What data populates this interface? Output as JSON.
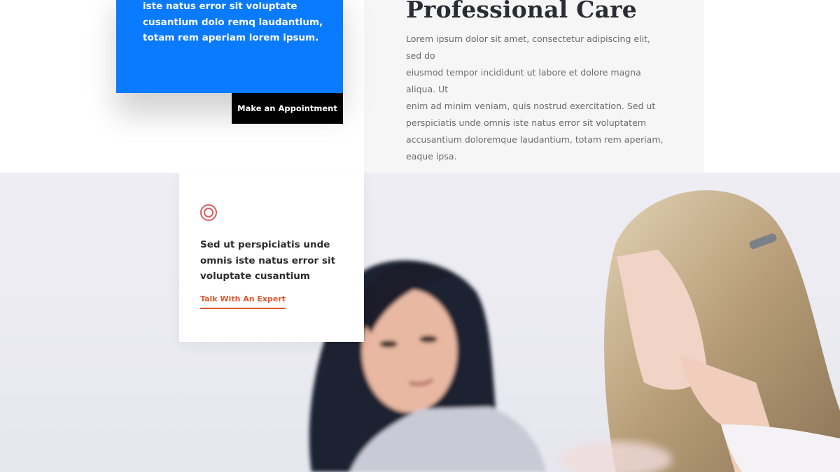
{
  "blue_card": {
    "text_lines": [
      "iste natus error sit voluptate",
      "cusantium dolo remq laudantium,",
      "totam rem aperiam lorem ipsum."
    ],
    "button_label": "Make an Appointment",
    "background_color": "#0a7aff"
  },
  "main": {
    "heading": "Professional Care",
    "paragraph_lines": [
      "Lorem ipsum dolor sit amet, consectetur adipiscing elit, sed do",
      "eiusmod tempor incididunt ut labore et dolore magna aliqua. Ut",
      "enim ad minim veniam, quis nostrud exercitation. Sed ut",
      "perspiciatis unde omnis iste natus error sit voluptatem",
      "accusantium doloremque laudantium, totam rem aperiam,",
      "eaque ipsa."
    ]
  },
  "feature_card": {
    "icon": "target-icon",
    "title_lines": [
      "Sed ut perspiciatis unde",
      "omnis iste natus error sit",
      "voluptate cusantium"
    ],
    "link_label": "Talk With An Expert",
    "accent_color": "#e4572e"
  },
  "photo": {
    "subject": "two-women-conversation-photo"
  }
}
